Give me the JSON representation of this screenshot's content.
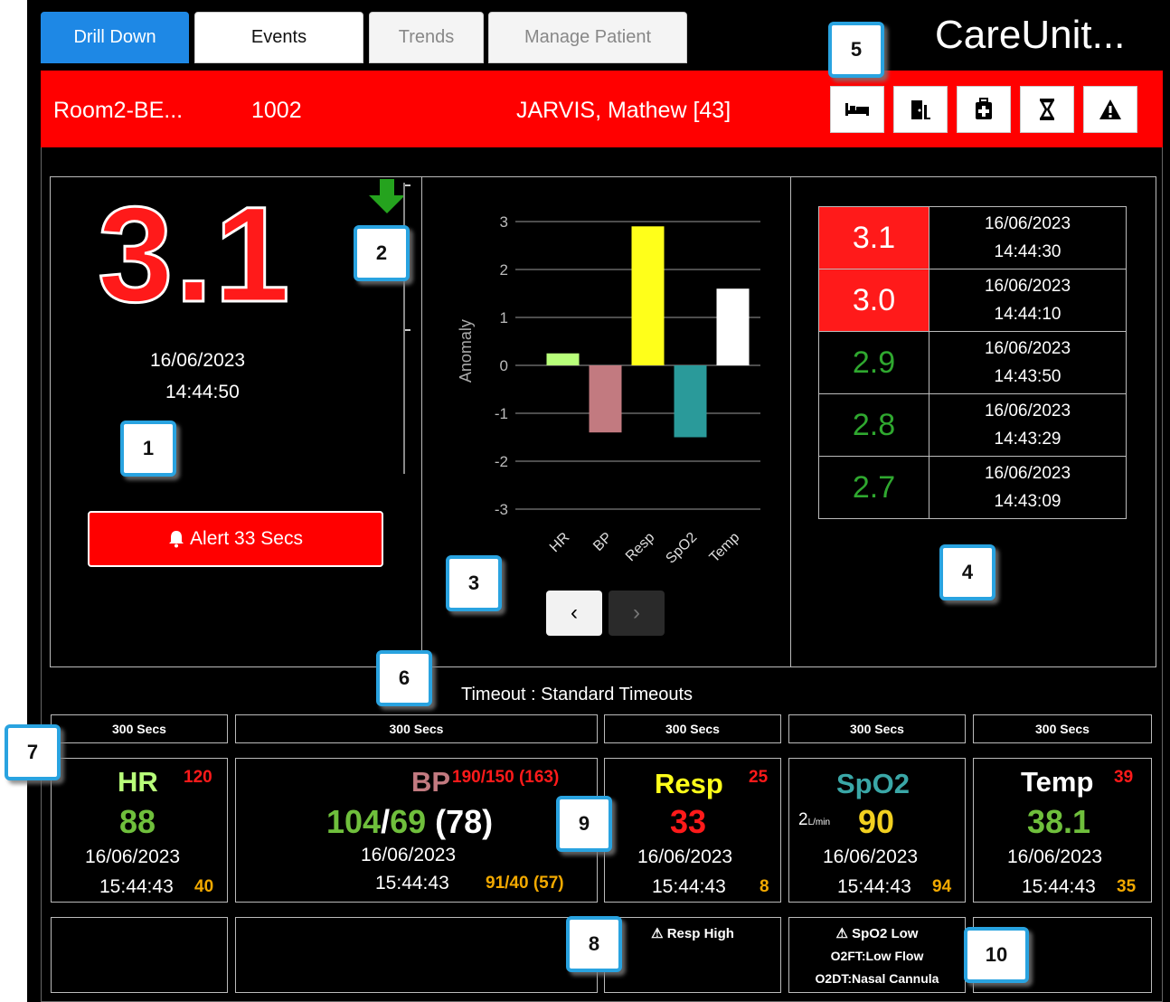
{
  "tabs": [
    {
      "label": "Drill Down"
    },
    {
      "label": "Events"
    },
    {
      "label": "Trends"
    },
    {
      "label": "Manage Patient"
    }
  ],
  "app_title": "CareUnit...",
  "patient_bar": {
    "room": "Room2-BE...",
    "id": "1002",
    "name": "JARVIS, Mathew [43]",
    "icons": [
      "bed-icon",
      "exit-door-icon",
      "medical-bag-icon",
      "hourglass-icon",
      "warning-icon"
    ]
  },
  "score": {
    "value": "3.1",
    "date": "16/06/2023",
    "time": "14:44:50",
    "trend": "down",
    "alert_label": "Alert 33 Secs"
  },
  "chart_data": {
    "type": "bar",
    "categories": [
      "HR",
      "BP",
      "Resp",
      "SpO2",
      "Temp"
    ],
    "values": [
      0.25,
      -1.4,
      2.9,
      -1.5,
      1.6
    ],
    "colors": [
      "#b8ff7a",
      "#c27a80",
      "#ffff1a",
      "#2a9a9a",
      "#ffffff"
    ],
    "ylabel": "Anomaly",
    "ylim": [
      -3,
      3
    ],
    "yticks": [
      "3",
      "2",
      "1",
      "0",
      "-1",
      "-2",
      "-3"
    ]
  },
  "history": [
    {
      "value": "3.1",
      "date": "16/06/2023",
      "time": "14:44:30",
      "level": "high"
    },
    {
      "value": "3.0",
      "date": "16/06/2023",
      "time": "14:44:10",
      "level": "high"
    },
    {
      "value": "2.9",
      "date": "16/06/2023",
      "time": "14:43:50",
      "level": "normal"
    },
    {
      "value": "2.8",
      "date": "16/06/2023",
      "time": "14:43:29",
      "level": "normal"
    },
    {
      "value": "2.7",
      "date": "16/06/2023",
      "time": "14:43:09",
      "level": "normal"
    }
  ],
  "timeout_label": "Timeout : Standard Timeouts",
  "vitals": [
    {
      "timeout": "300 Secs",
      "name": "HR",
      "high": "120",
      "value": "88",
      "date": "16/06/2023",
      "time": "15:44:43",
      "low": "40",
      "alert": ""
    },
    {
      "timeout": "300 Secs",
      "name": "BP",
      "high": "190/150 (163)",
      "value_a": "104",
      "value_sep": "/",
      "value_b": "69",
      "value_c": " (78)",
      "date": "16/06/2023",
      "time": "15:44:43",
      "low": "91/40 (57)",
      "alert": ""
    },
    {
      "timeout": "300 Secs",
      "name": "Resp",
      "high": "25",
      "value": "33",
      "date": "16/06/2023",
      "time": "15:44:43",
      "low": "8",
      "alert": "Resp High"
    },
    {
      "timeout": "300 Secs",
      "name": "SpO2",
      "high": "",
      "flow": "2",
      "flow_unit": "L/min",
      "value": "90",
      "date": "16/06/2023",
      "time": "15:44:43",
      "low": "94",
      "alert": "SpO2 Low",
      "alert_line2": "O2FT:Low Flow",
      "alert_line3": "O2DT:Nasal Cannula"
    },
    {
      "timeout": "300 Secs",
      "name": "Temp",
      "high": "39",
      "value": "38.1",
      "date": "16/06/2023",
      "time": "15:44:43",
      "low": "35",
      "alert": ""
    }
  ],
  "callouts": [
    "1",
    "2",
    "3",
    "4",
    "5",
    "6",
    "7",
    "8",
    "9",
    "10"
  ],
  "nav": {
    "prev": "‹",
    "next": "›"
  }
}
